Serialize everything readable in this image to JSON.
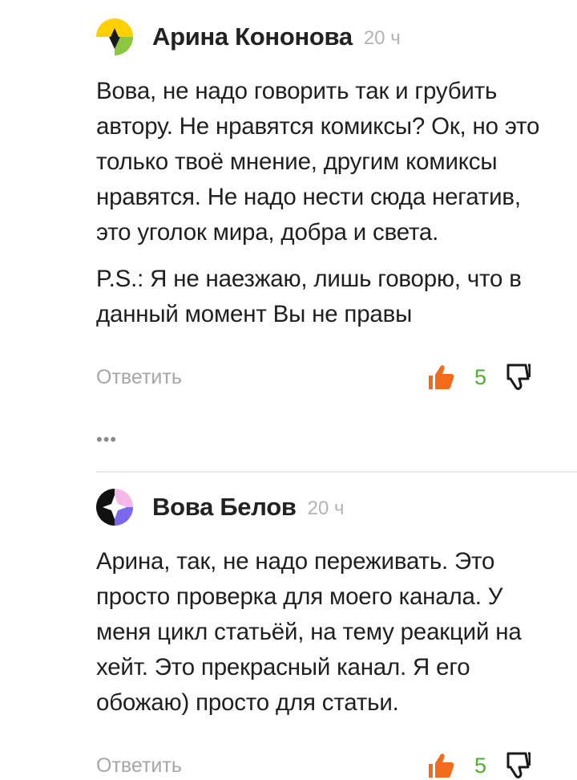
{
  "comments": [
    {
      "author": "Арина Кононова",
      "time": "20 ч",
      "avatar_icon": "yellow-green-avatar-icon",
      "paragraphs": [
        "Вова, не надо говорить так и грубить автору. Не нравятся комиксы? Ок, но это только твоё мнение, другим комиксы нравятся. Не надо нести сюда негатив, это уголок мира, добра и света.",
        "P.S.: Я не наезжаю, лишь говорю, что в данный момент Вы не правы"
      ],
      "reply_label": "Ответить",
      "likes": "5"
    },
    {
      "author": "Вова Белов",
      "time": "20 ч",
      "avatar_icon": "black-purple-avatar-icon",
      "paragraphs": [
        "Арина, так, не надо переживать. Это просто проверка для моего канала. У меня цикл статьёй, на тему реакций на хейт. Это прекрасный канал. Я его обожаю) просто для статьи."
      ],
      "reply_label": "Ответить",
      "likes": "5"
    }
  ],
  "more_label": "•••",
  "colors": {
    "like_accent": "#f26a1b",
    "like_count": "#4caf2f",
    "muted_text": "#a6a6a6"
  }
}
